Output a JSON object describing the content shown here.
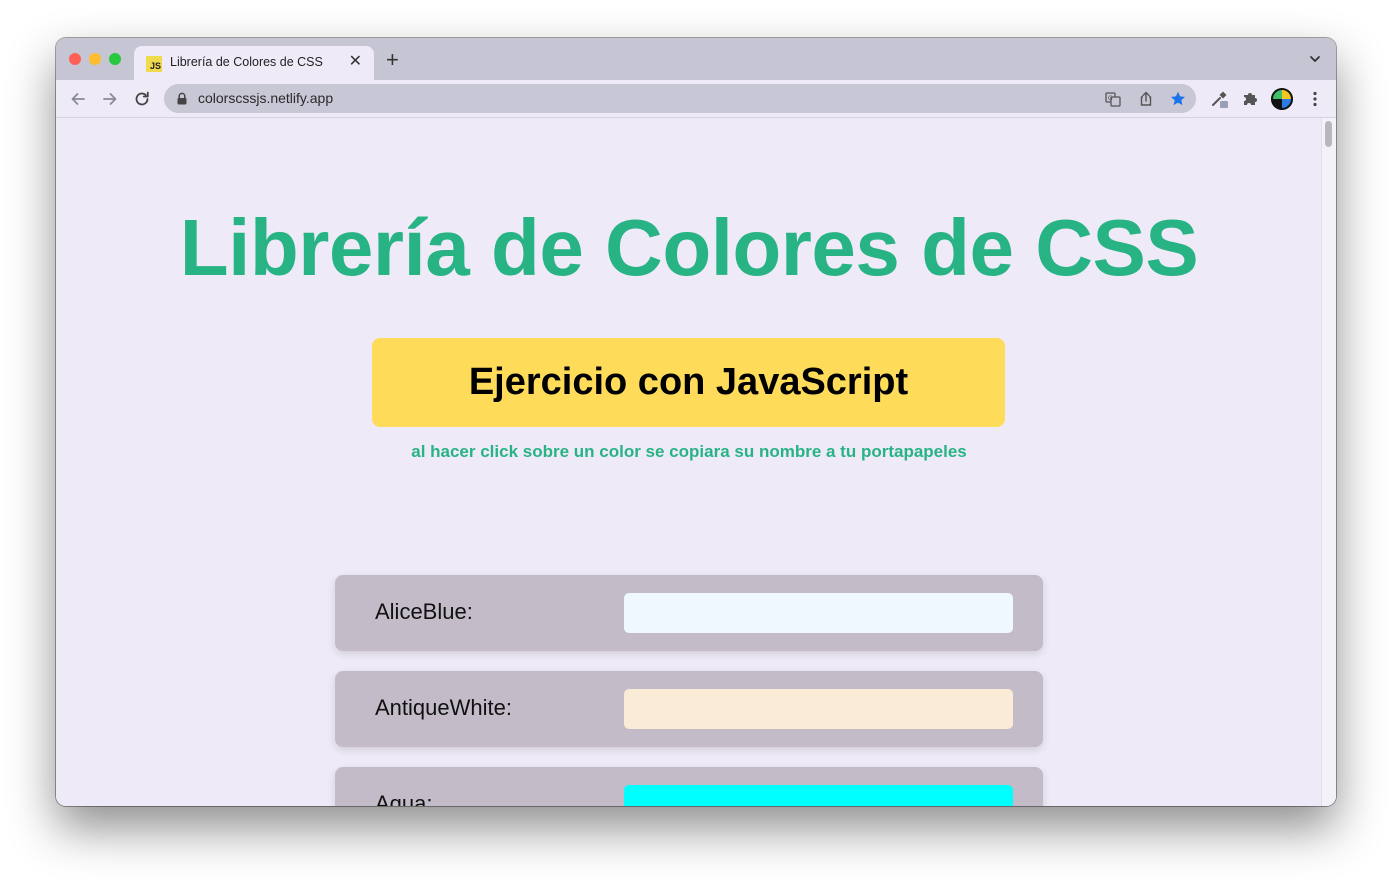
{
  "browser": {
    "tab": {
      "favicon_text": "JS",
      "title": "Librería de Colores de CSS",
      "close_glyph": "✕"
    },
    "new_tab_glyph": "+",
    "url": "colorscssjs.netlify.app",
    "icons": {
      "back": "back-arrow-icon",
      "forward": "forward-arrow-icon",
      "reload": "reload-icon",
      "lock": "lock-icon",
      "translate": "translate-icon",
      "share": "share-icon",
      "bookmark": "star-icon",
      "eyedropper": "eyedropper-extension-icon",
      "extensions": "puzzle-icon",
      "menu": "kebab-menu-icon"
    },
    "colors": {
      "tabstrip": "#c5c5d4",
      "toolbar": "#efeaf8",
      "bookmark_star": "#1a73e8"
    }
  },
  "page": {
    "title": "Librería de Colores de CSS",
    "button_label": "Ejercicio con JavaScript",
    "hint": "al hacer click sobre un color se copiara su nombre a tu portapapeles",
    "colors": {
      "background": "#efeaf8",
      "title": "#28b385",
      "button": "#fedc5a",
      "card": "#c3bcc8"
    },
    "color_list": [
      {
        "label": "AliceBlue:",
        "swatch": "#f0f8ff"
      },
      {
        "label": "AntiqueWhite:",
        "swatch": "#faebd7"
      },
      {
        "label": "Aqua:",
        "swatch": "#00ffff"
      }
    ]
  }
}
